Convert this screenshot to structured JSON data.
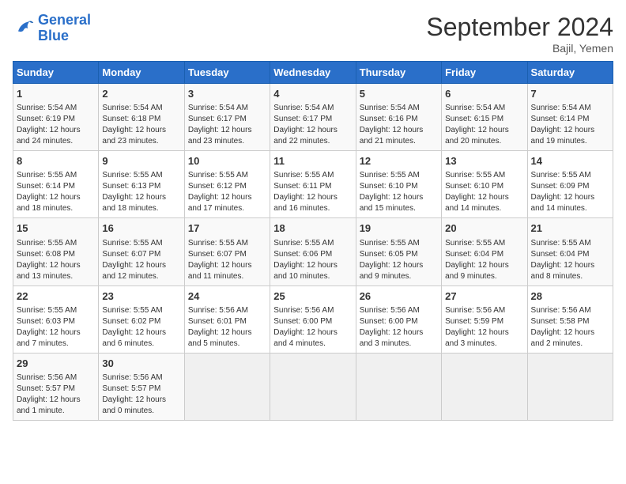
{
  "logo": {
    "line1": "General",
    "line2": "Blue"
  },
  "title": "September 2024",
  "location": "Bajil, Yemen",
  "days_of_week": [
    "Sunday",
    "Monday",
    "Tuesday",
    "Wednesday",
    "Thursday",
    "Friday",
    "Saturday"
  ],
  "weeks": [
    [
      {
        "day": "1",
        "info": "Sunrise: 5:54 AM\nSunset: 6:19 PM\nDaylight: 12 hours\nand 24 minutes."
      },
      {
        "day": "2",
        "info": "Sunrise: 5:54 AM\nSunset: 6:18 PM\nDaylight: 12 hours\nand 23 minutes."
      },
      {
        "day": "3",
        "info": "Sunrise: 5:54 AM\nSunset: 6:17 PM\nDaylight: 12 hours\nand 23 minutes."
      },
      {
        "day": "4",
        "info": "Sunrise: 5:54 AM\nSunset: 6:17 PM\nDaylight: 12 hours\nand 22 minutes."
      },
      {
        "day": "5",
        "info": "Sunrise: 5:54 AM\nSunset: 6:16 PM\nDaylight: 12 hours\nand 21 minutes."
      },
      {
        "day": "6",
        "info": "Sunrise: 5:54 AM\nSunset: 6:15 PM\nDaylight: 12 hours\nand 20 minutes."
      },
      {
        "day": "7",
        "info": "Sunrise: 5:54 AM\nSunset: 6:14 PM\nDaylight: 12 hours\nand 19 minutes."
      }
    ],
    [
      {
        "day": "8",
        "info": "Sunrise: 5:55 AM\nSunset: 6:14 PM\nDaylight: 12 hours\nand 18 minutes."
      },
      {
        "day": "9",
        "info": "Sunrise: 5:55 AM\nSunset: 6:13 PM\nDaylight: 12 hours\nand 18 minutes."
      },
      {
        "day": "10",
        "info": "Sunrise: 5:55 AM\nSunset: 6:12 PM\nDaylight: 12 hours\nand 17 minutes."
      },
      {
        "day": "11",
        "info": "Sunrise: 5:55 AM\nSunset: 6:11 PM\nDaylight: 12 hours\nand 16 minutes."
      },
      {
        "day": "12",
        "info": "Sunrise: 5:55 AM\nSunset: 6:10 PM\nDaylight: 12 hours\nand 15 minutes."
      },
      {
        "day": "13",
        "info": "Sunrise: 5:55 AM\nSunset: 6:10 PM\nDaylight: 12 hours\nand 14 minutes."
      },
      {
        "day": "14",
        "info": "Sunrise: 5:55 AM\nSunset: 6:09 PM\nDaylight: 12 hours\nand 14 minutes."
      }
    ],
    [
      {
        "day": "15",
        "info": "Sunrise: 5:55 AM\nSunset: 6:08 PM\nDaylight: 12 hours\nand 13 minutes."
      },
      {
        "day": "16",
        "info": "Sunrise: 5:55 AM\nSunset: 6:07 PM\nDaylight: 12 hours\nand 12 minutes."
      },
      {
        "day": "17",
        "info": "Sunrise: 5:55 AM\nSunset: 6:07 PM\nDaylight: 12 hours\nand 11 minutes."
      },
      {
        "day": "18",
        "info": "Sunrise: 5:55 AM\nSunset: 6:06 PM\nDaylight: 12 hours\nand 10 minutes."
      },
      {
        "day": "19",
        "info": "Sunrise: 5:55 AM\nSunset: 6:05 PM\nDaylight: 12 hours\nand 9 minutes."
      },
      {
        "day": "20",
        "info": "Sunrise: 5:55 AM\nSunset: 6:04 PM\nDaylight: 12 hours\nand 9 minutes."
      },
      {
        "day": "21",
        "info": "Sunrise: 5:55 AM\nSunset: 6:04 PM\nDaylight: 12 hours\nand 8 minutes."
      }
    ],
    [
      {
        "day": "22",
        "info": "Sunrise: 5:55 AM\nSunset: 6:03 PM\nDaylight: 12 hours\nand 7 minutes."
      },
      {
        "day": "23",
        "info": "Sunrise: 5:55 AM\nSunset: 6:02 PM\nDaylight: 12 hours\nand 6 minutes."
      },
      {
        "day": "24",
        "info": "Sunrise: 5:56 AM\nSunset: 6:01 PM\nDaylight: 12 hours\nand 5 minutes."
      },
      {
        "day": "25",
        "info": "Sunrise: 5:56 AM\nSunset: 6:00 PM\nDaylight: 12 hours\nand 4 minutes."
      },
      {
        "day": "26",
        "info": "Sunrise: 5:56 AM\nSunset: 6:00 PM\nDaylight: 12 hours\nand 3 minutes."
      },
      {
        "day": "27",
        "info": "Sunrise: 5:56 AM\nSunset: 5:59 PM\nDaylight: 12 hours\nand 3 minutes."
      },
      {
        "day": "28",
        "info": "Sunrise: 5:56 AM\nSunset: 5:58 PM\nDaylight: 12 hours\nand 2 minutes."
      }
    ],
    [
      {
        "day": "29",
        "info": "Sunrise: 5:56 AM\nSunset: 5:57 PM\nDaylight: 12 hours\nand 1 minute."
      },
      {
        "day": "30",
        "info": "Sunrise: 5:56 AM\nSunset: 5:57 PM\nDaylight: 12 hours\nand 0 minutes."
      },
      {
        "day": "",
        "info": ""
      },
      {
        "day": "",
        "info": ""
      },
      {
        "day": "",
        "info": ""
      },
      {
        "day": "",
        "info": ""
      },
      {
        "day": "",
        "info": ""
      }
    ]
  ]
}
